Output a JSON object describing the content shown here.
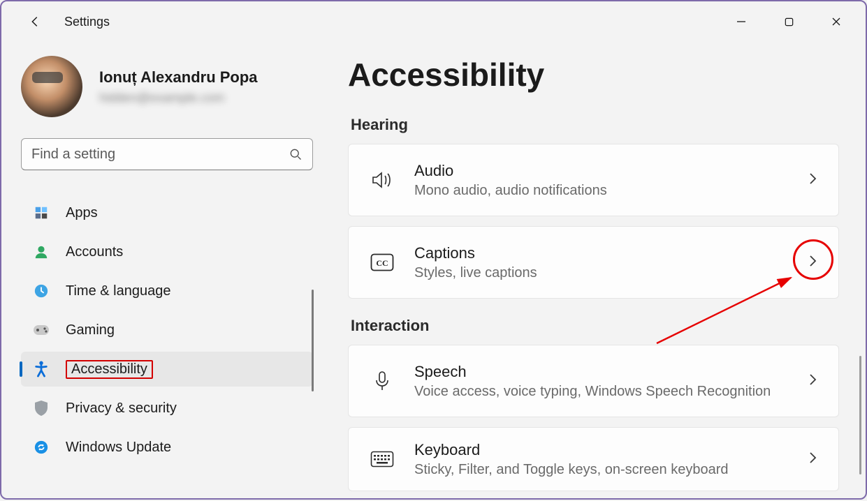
{
  "app_title": "Settings",
  "user": {
    "name": "Ionuț Alexandru Popa",
    "email": "hidden@example.com"
  },
  "search": {
    "placeholder": "Find a setting"
  },
  "nav": {
    "items": [
      {
        "label": "Apps",
        "icon": "apps"
      },
      {
        "label": "Accounts",
        "icon": "person"
      },
      {
        "label": "Time & language",
        "icon": "clock"
      },
      {
        "label": "Gaming",
        "icon": "gamepad"
      },
      {
        "label": "Accessibility",
        "icon": "accessibility",
        "active": true
      },
      {
        "label": "Privacy & security",
        "icon": "shield"
      },
      {
        "label": "Windows Update",
        "icon": "update"
      }
    ]
  },
  "page": {
    "title": "Accessibility",
    "sections": [
      {
        "heading": "Hearing",
        "cards": [
          {
            "icon": "audio",
            "title": "Audio",
            "subtitle": "Mono audio, audio notifications"
          },
          {
            "icon": "cc",
            "title": "Captions",
            "subtitle": "Styles, live captions"
          }
        ]
      },
      {
        "heading": "Interaction",
        "cards": [
          {
            "icon": "mic",
            "title": "Speech",
            "subtitle": "Voice access, voice typing, Windows Speech Recognition"
          },
          {
            "icon": "keyboard",
            "title": "Keyboard",
            "subtitle": "Sticky, Filter, and Toggle keys, on-screen keyboard"
          }
        ]
      }
    ]
  }
}
